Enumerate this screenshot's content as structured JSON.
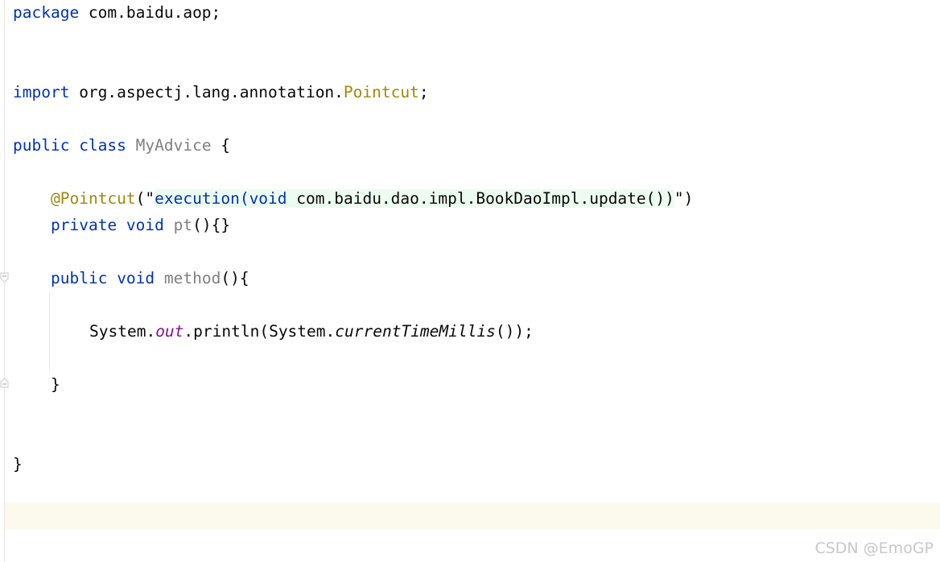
{
  "editor": {
    "lines": {
      "package_kw": "package",
      "package_name": " com.baidu.aop;",
      "import_kw": "import",
      "import_pkg": " org.aspectj.lang.annotation.",
      "import_cls": "Pointcut",
      "import_semi": ";",
      "class_public": "public",
      "class_kw": " class ",
      "class_name": "MyAdvice",
      "class_brace": " {",
      "annotation": "@Pointcut",
      "annotation_open": "(\"",
      "annotation_exec": "execution(",
      "annotation_void": "void",
      "annotation_target": " com.baidu.dao.impl.BookDaoImpl.update())",
      "annotation_close": "\")",
      "pt_private": "private",
      "pt_void": " void ",
      "pt_name": "pt",
      "pt_body": "(){}",
      "method_public": "public",
      "method_void": " void ",
      "method_name": "method",
      "method_open": "(){",
      "stmt_system": "System.",
      "stmt_out": "out",
      "stmt_println": ".println(System.",
      "stmt_ctm": "currentTimeMillis",
      "stmt_end": "());",
      "method_close": "}",
      "class_close": "}"
    }
  },
  "watermark": "CSDN @EmoGP"
}
